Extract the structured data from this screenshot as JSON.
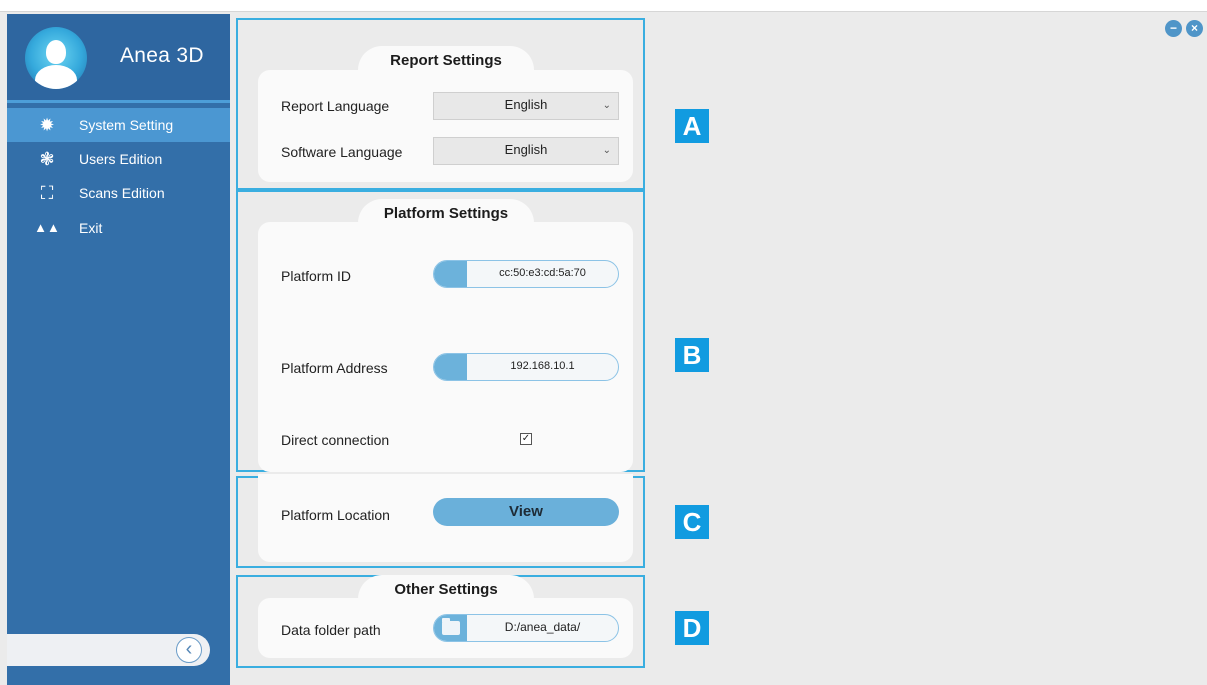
{
  "app": {
    "title": "Anea 3D"
  },
  "window": {
    "minimize_icon": "minus-circle",
    "close_icon": "x-circle"
  },
  "sidebar": {
    "items": [
      {
        "label": "System Setting",
        "icon": "gear-icon",
        "active": true
      },
      {
        "label": "Users Edition",
        "icon": "users-gear-icon",
        "active": false
      },
      {
        "label": "Scans Edition",
        "icon": "scan-frame-icon",
        "active": false
      },
      {
        "label": "Exit",
        "icon": "exit-icon",
        "active": false
      }
    ],
    "collapse_icon": "chevron-left"
  },
  "report": {
    "title": "Report Settings",
    "report_language_label": "Report Language",
    "report_language_value": "English",
    "software_language_label": "Software Language",
    "software_language_value": "English"
  },
  "platform": {
    "title": "Platform Settings",
    "id_label": "Platform ID",
    "id_value": "cc:50:e3:cd:5a:70",
    "address_label": "Platform Address",
    "address_value": "192.168.10.1",
    "direct_label": "Direct connection",
    "direct_checked": true
  },
  "location": {
    "label": "Platform Location",
    "button_label": "View"
  },
  "other": {
    "title": "Other Settings",
    "folder_label": "Data folder path",
    "folder_value": "D:/anea_data/"
  },
  "badges": {
    "a": "A",
    "b": "B",
    "c": "C",
    "d": "D"
  },
  "colors": {
    "sidebar": "#336fa9",
    "active_item": "#4b97d2",
    "accent": "#3aaee0",
    "badge": "#119be0",
    "pill": "#6cb2db"
  }
}
